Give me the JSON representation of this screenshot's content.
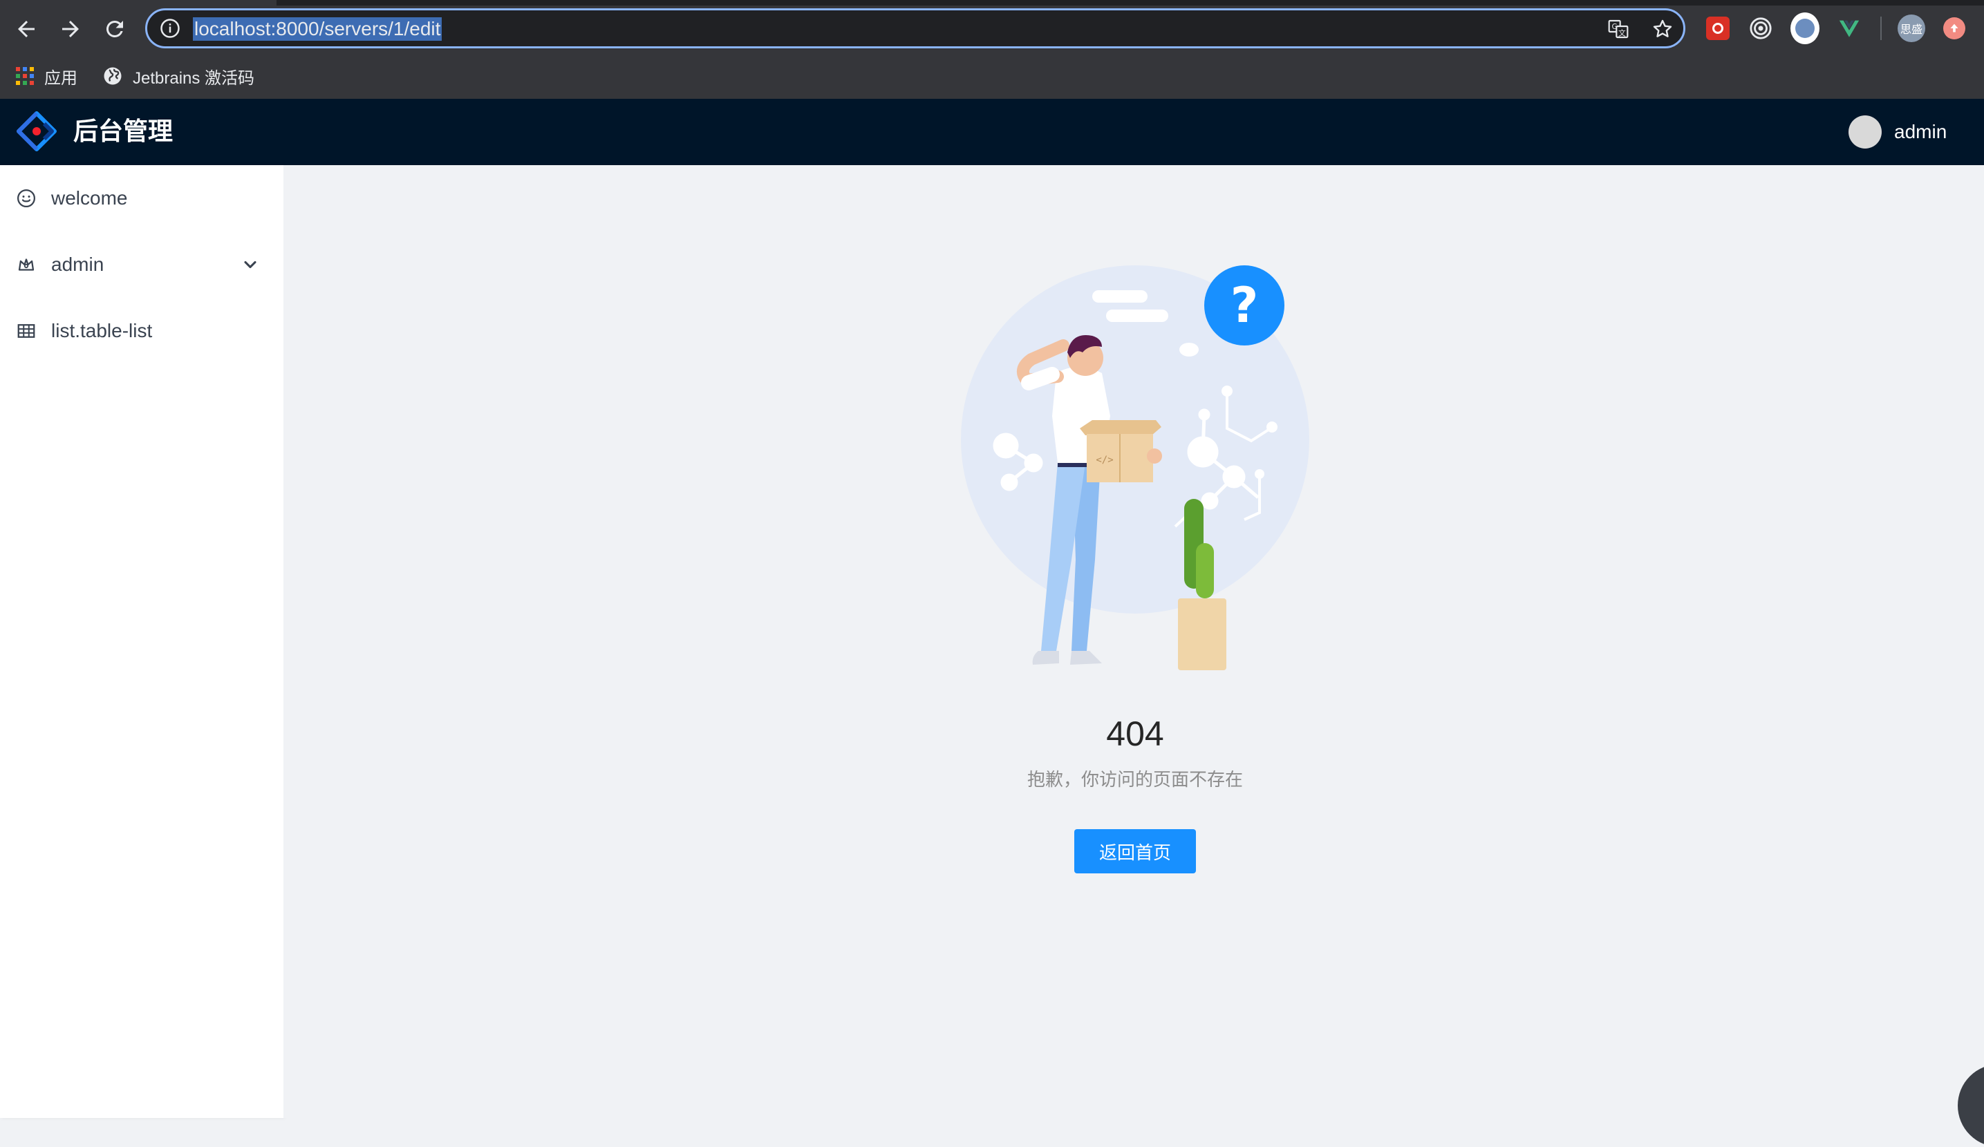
{
  "browser": {
    "url": "localhost:8000/servers/1/edit",
    "bookmarks": [
      {
        "label": "应用",
        "icon": "apps-grid-icon"
      },
      {
        "label": "Jetbrains 激活码",
        "icon": "globe-icon"
      }
    ],
    "extensions": [
      "red-extension-icon",
      "target-extension-icon",
      "compass-extension-icon",
      "vue-extension-icon",
      "profile-avatar-icon",
      "update-icon"
    ],
    "profile_label": "思盛"
  },
  "app": {
    "title": "后台管理",
    "user": "admin",
    "accent": "#1890ff",
    "header_bg": "#001529"
  },
  "sidebar": {
    "items": [
      {
        "label": "welcome",
        "icon": "smile-icon"
      },
      {
        "label": "admin",
        "icon": "crown-icon",
        "expandable": true
      },
      {
        "label": "list.table-list",
        "icon": "table-icon"
      }
    ]
  },
  "error_page": {
    "code": "404",
    "message": "抱歉，你访问的页面不存在",
    "button_label": "返回首页"
  }
}
